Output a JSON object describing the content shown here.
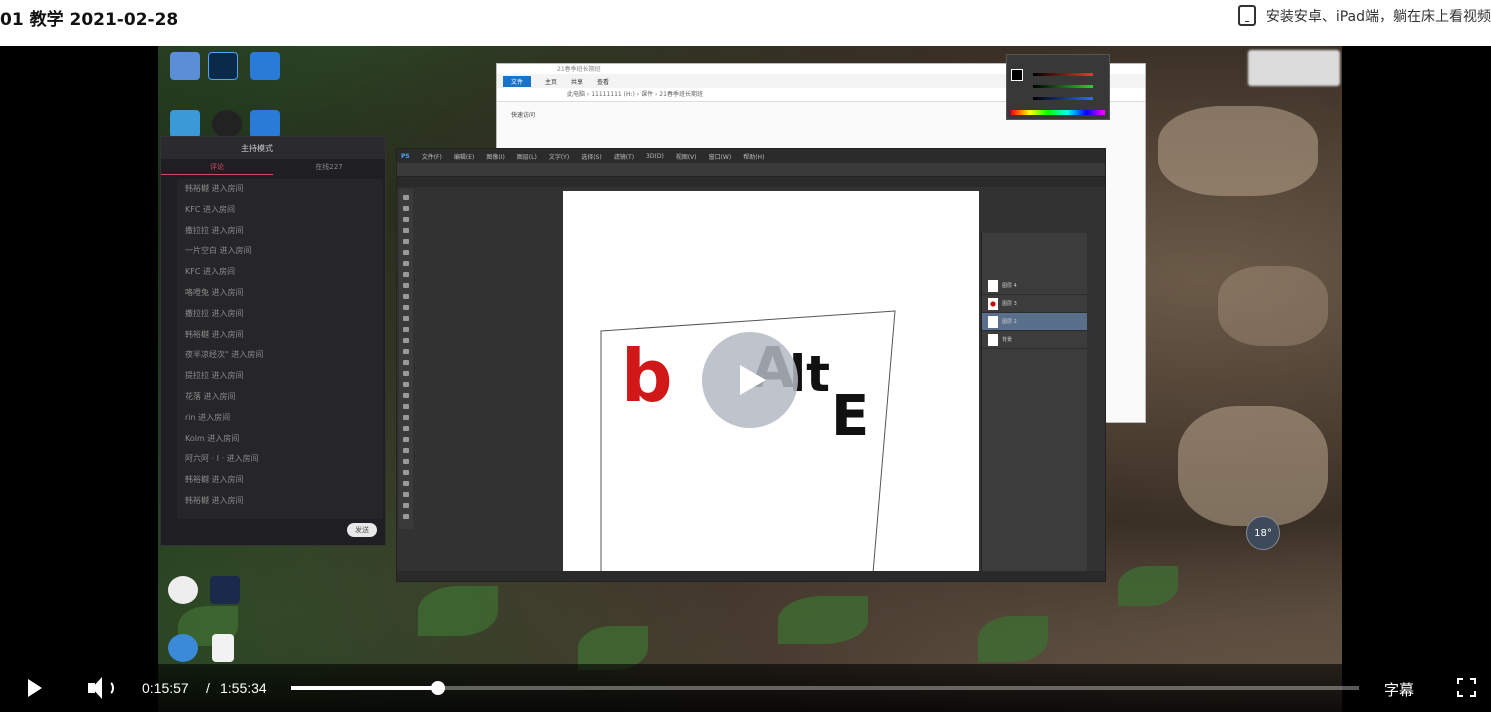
{
  "header": {
    "title": "01 教学 2021-02-28",
    "app_promo": "安装安卓、iPad端，躺在床上看视频"
  },
  "player": {
    "current_time": "0:15:57",
    "separator": "/",
    "duration": "1:55:34",
    "progress_fraction": 0.138,
    "subtitle_label": "字幕"
  },
  "colors": {
    "accent": "#d44b5b",
    "control_bar": "#000000",
    "progress_fill": "#ffffff"
  },
  "video_content": {
    "chat_window": {
      "title": "主持模式",
      "tabs": [
        "评论",
        "在线227"
      ],
      "messages": [
        "韩裕樾 进入房间",
        "KFC 进入房间",
        "撒拉拉 进入房间",
        "一片空白 进入房间",
        "KFC 进入房间",
        "咯噔兔 进入房间",
        "撒拉拉 进入房间",
        "韩裕樾 进入房间",
        "夜半凉经次\" 进入房间",
        "提拉拉 进入房间",
        "花落 进入房间",
        "rin 进入房间",
        "Kolm 进入房间",
        "阿六阿 · I · 进入房间",
        "韩裕樾 进入房间",
        "韩裕樾 进入房间"
      ],
      "send_label": "发送"
    },
    "explorer": {
      "path": "21春季班长期班",
      "ribbon": [
        "文件",
        "主页",
        "共享",
        "查看"
      ],
      "breadcrumb": "此电脑 › 11111111 (H:) › 课件 › 21春季班长期班",
      "quick_access": "快速访问"
    },
    "photoshop": {
      "menu": [
        "PS",
        "文件(F)",
        "编辑(E)",
        "图像(I)",
        "图层(L)",
        "文字(Y)",
        "选择(S)",
        "滤镜(T)",
        "3D(D)",
        "视图(V)",
        "窗口(W)",
        "帮助(H)"
      ],
      "layers": [
        "图层 4",
        "图层 3",
        "图层 2",
        "背景"
      ],
      "canvas_text": [
        "b",
        "A",
        "lt",
        "E"
      ]
    },
    "weather": "18°"
  }
}
